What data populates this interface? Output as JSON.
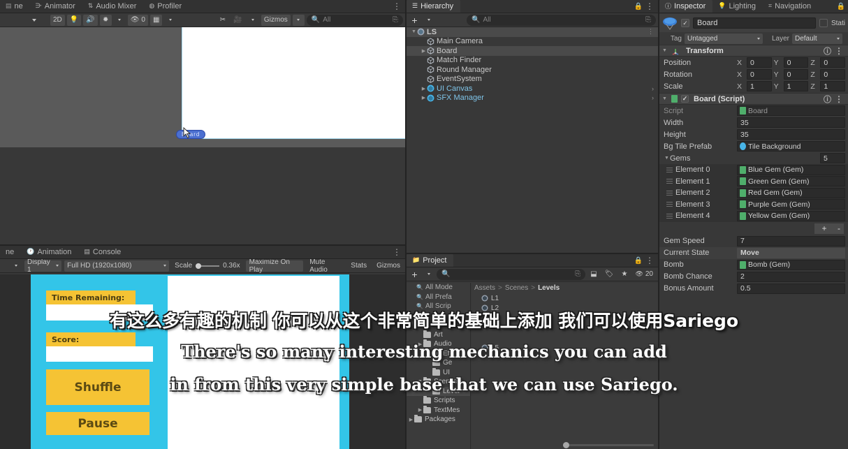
{
  "app": {
    "theme_bg": "#383838",
    "accent_blue": "#4b6fd0"
  },
  "scene_panel": {
    "tabs": [
      {
        "label": "ne",
        "icon": "timeline-icon",
        "active": false
      },
      {
        "label": "Animator",
        "icon": "animator-icon",
        "active": false
      },
      {
        "label": "Audio Mixer",
        "icon": "audio-mixer-icon",
        "active": false
      },
      {
        "label": "Profiler",
        "icon": "profiler-icon",
        "active": false
      }
    ],
    "toolbar": {
      "draw_mode": "",
      "two_d_label": "2D",
      "lighting_icon": "lightbulb-icon",
      "audio_icon": "speaker-icon",
      "fx_icon": "effects-icon",
      "hidden_count": "0",
      "grid_icon": "grid-icon",
      "tools_icon": "scissors-icon",
      "camera_icon": "camera-icon",
      "gizmos_label": "Gizmos",
      "search_placeholder": "All"
    },
    "object_label": "Board",
    "menu_icon": "kebab-menu-icon"
  },
  "game_panel": {
    "tabs": [
      {
        "label": "ne",
        "icon": "game-icon",
        "active": false
      },
      {
        "label": "Animation",
        "icon": "animation-icon",
        "active": false
      },
      {
        "label": "Console",
        "icon": "console-icon",
        "active": false
      }
    ],
    "toolbar": {
      "display": "Display 1",
      "resolution": "Full HD (1920x1080)",
      "scale_label": "Scale",
      "scale_value": "0.36x",
      "maximize_on_play": "Maximize On Play",
      "mute_audio": "Mute Audio",
      "stats": "Stats",
      "gizmos": "Gizmos"
    },
    "screen": {
      "bg_color": "#33c5e8",
      "board_color": "#ffffff",
      "time_label": "Time Remaining:",
      "score_label": "Score:",
      "shuffle_label": "Shuffle",
      "pause_label": "Pause"
    }
  },
  "hierarchy": {
    "tab_label": "Hierarchy",
    "tab_icon": "hierarchy-icon",
    "lock_icon": "lock-icon",
    "menu_icon": "kebab-menu-icon",
    "add_label": "+",
    "search_placeholder": "All",
    "items": [
      {
        "label": "LS",
        "depth": 0,
        "icon": "scene-icon",
        "expanded": true,
        "selected": false,
        "has_children": true,
        "prefab": false,
        "chevron": false
      },
      {
        "label": "Main Camera",
        "depth": 1,
        "icon": "gameobject-icon",
        "expanded": false,
        "selected": false,
        "has_children": false,
        "prefab": false,
        "chevron": false
      },
      {
        "label": "Board",
        "depth": 1,
        "icon": "gameobject-icon",
        "expanded": false,
        "selected": true,
        "has_children": true,
        "prefab": false,
        "chevron": false
      },
      {
        "label": "Match Finder",
        "depth": 1,
        "icon": "gameobject-icon",
        "expanded": false,
        "selected": false,
        "has_children": false,
        "prefab": false,
        "chevron": false
      },
      {
        "label": "Round Manager",
        "depth": 1,
        "icon": "gameobject-icon",
        "expanded": false,
        "selected": false,
        "has_children": false,
        "prefab": false,
        "chevron": false
      },
      {
        "label": "EventSystem",
        "depth": 1,
        "icon": "gameobject-icon",
        "expanded": false,
        "selected": false,
        "has_children": false,
        "prefab": false,
        "chevron": false
      },
      {
        "label": "UI Canvas",
        "depth": 1,
        "icon": "prefab-icon",
        "expanded": false,
        "selected": false,
        "has_children": true,
        "prefab": true,
        "chevron": true
      },
      {
        "label": "SFX Manager",
        "depth": 1,
        "icon": "prefab-icon",
        "expanded": false,
        "selected": false,
        "has_children": true,
        "prefab": true,
        "chevron": true
      }
    ]
  },
  "project": {
    "tab_label": "Project",
    "tab_icon": "folder-icon",
    "lock_icon": "lock-icon",
    "menu_icon": "kebab-menu-icon",
    "add_label": "+",
    "search_placeholder": "",
    "toolbar_badge": "20",
    "breadcrumb": [
      "Assets",
      "Scenes",
      "Levels"
    ],
    "filters": [
      {
        "label": "All Mode",
        "icon": "search-icon"
      },
      {
        "label": "All Prefa",
        "icon": "search-icon"
      },
      {
        "label": "All Scrip",
        "icon": "search-icon"
      }
    ],
    "tree": [
      {
        "label": "Art",
        "depth": 1,
        "expanded": false,
        "selected": false,
        "has_children": false
      },
      {
        "label": "Audio",
        "depth": 1,
        "expanded": false,
        "selected": false,
        "has_children": true
      },
      {
        "label": "Effect",
        "depth": 2,
        "expanded": false,
        "selected": false,
        "has_children": false
      },
      {
        "label": "Ge",
        "depth": 2,
        "expanded": false,
        "selected": false,
        "has_children": false
      },
      {
        "label": "UI",
        "depth": 2,
        "expanded": false,
        "selected": false,
        "has_children": false
      },
      {
        "label": "Scenes",
        "depth": 1,
        "expanded": true,
        "selected": false,
        "has_children": true
      },
      {
        "label": "Level",
        "depth": 2,
        "expanded": false,
        "selected": true,
        "has_children": false
      },
      {
        "label": "Scripts",
        "depth": 1,
        "expanded": false,
        "selected": false,
        "has_children": false
      },
      {
        "label": "TextMes",
        "depth": 1,
        "expanded": false,
        "selected": false,
        "has_children": true
      },
      {
        "label": "Packages",
        "depth": 0,
        "expanded": false,
        "selected": false,
        "has_children": true
      }
    ],
    "assets": [
      {
        "label": "L1",
        "icon": "scene-asset-icon"
      },
      {
        "label": "L2",
        "icon": "scene-asset-icon"
      },
      {
        "label": "L5",
        "icon": "scene-asset-icon"
      }
    ]
  },
  "inspector": {
    "tabs": [
      {
        "label": "Inspector",
        "icon": "info-icon",
        "active": true
      },
      {
        "label": "Lighting",
        "icon": "lightbulb-icon",
        "active": false
      },
      {
        "label": "Navigation",
        "icon": "navigation-icon",
        "active": false
      }
    ],
    "object": {
      "name": "Board",
      "enabled": true,
      "static_label": "Stati",
      "tag_label": "Tag",
      "tag_value": "Untagged",
      "layer_label": "Layer",
      "layer_value": "Default"
    },
    "transform": {
      "title": "Transform",
      "icon": "transform-icon",
      "rows": [
        {
          "label": "Position",
          "x": "0",
          "y": "0",
          "z": "0"
        },
        {
          "label": "Rotation",
          "x": "0",
          "y": "0",
          "z": "0"
        },
        {
          "label": "Scale",
          "x": "1",
          "y": "1",
          "z": "1"
        }
      ]
    },
    "board_script": {
      "title": "Board (Script)",
      "icon": "script-icon",
      "enabled": true,
      "script_label": "Script",
      "script_value": "Board",
      "fields_top": [
        {
          "label": "Width",
          "value": "35",
          "type": "text"
        },
        {
          "label": "Height",
          "value": "35",
          "type": "text"
        },
        {
          "label": "Bg Tile Prefab",
          "value": "Tile Background",
          "type": "object-prefab"
        }
      ],
      "gems_label": "Gems",
      "gems_count": "5",
      "gems": [
        {
          "label": "Element 0",
          "value": "Blue Gem (Gem)"
        },
        {
          "label": "Element 1",
          "value": "Green Gem (Gem)"
        },
        {
          "label": "Element 2",
          "value": "Red Gem (Gem)"
        },
        {
          "label": "Element 3",
          "value": "Purple Gem (Gem)"
        },
        {
          "label": "Element 4",
          "value": "Yellow Gem (Gem)"
        }
      ],
      "list_add": "+",
      "list_remove": "-",
      "fields_bottom": [
        {
          "label": "Gem Speed",
          "value": "7",
          "type": "text"
        },
        {
          "label": "Current State",
          "value": "Move",
          "type": "enum"
        },
        {
          "label": "Bomb",
          "value": "Bomb (Gem)",
          "type": "object-script"
        },
        {
          "label": "Bomb Chance",
          "value": "2",
          "type": "text"
        },
        {
          "label": "Bonus Amount",
          "value": "0.5",
          "type": "text"
        }
      ]
    }
  },
  "subtitles": {
    "chinese": "有这么多有趣的机制 你可以从这个非常简单的基础上添加 我们可以使用Sariego",
    "english_line1": "There's so many interesting mechanics you can add",
    "english_line2": "in from this very simple base that we can use Sariego."
  }
}
